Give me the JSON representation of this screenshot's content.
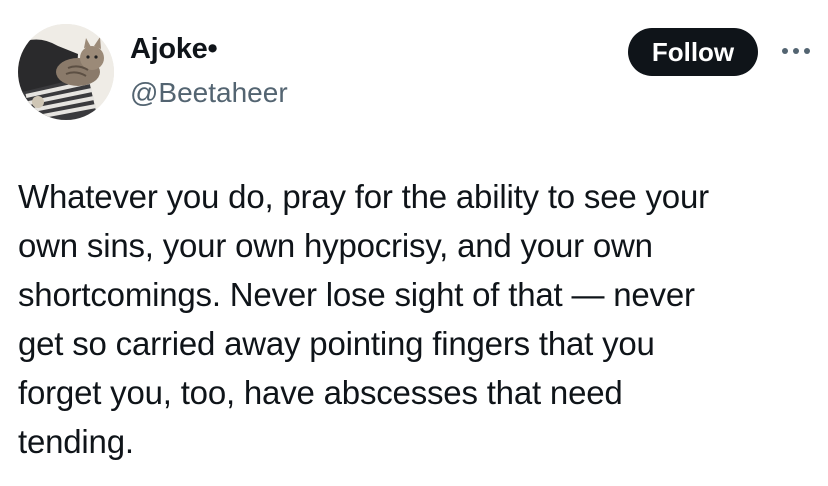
{
  "user": {
    "display_name": "Ajoke•",
    "handle": "@Beetaheer"
  },
  "actions": {
    "follow_label": "Follow",
    "more_icon": "more-horizontal-icon"
  },
  "tweet": {
    "text_lines": [
      "Whatever you do, pray for the ability to see your",
      "own sins, your own hypocrisy, and your own",
      "shortcomings. Never lose sight of that — never",
      "get so carried away pointing fingers that you",
      "forget you, too, have abscesses that need",
      "tending."
    ]
  },
  "colors": {
    "text_primary": "#0f1419",
    "text_secondary": "#536471",
    "follow_bg": "#0f1419",
    "follow_text": "#ffffff"
  }
}
